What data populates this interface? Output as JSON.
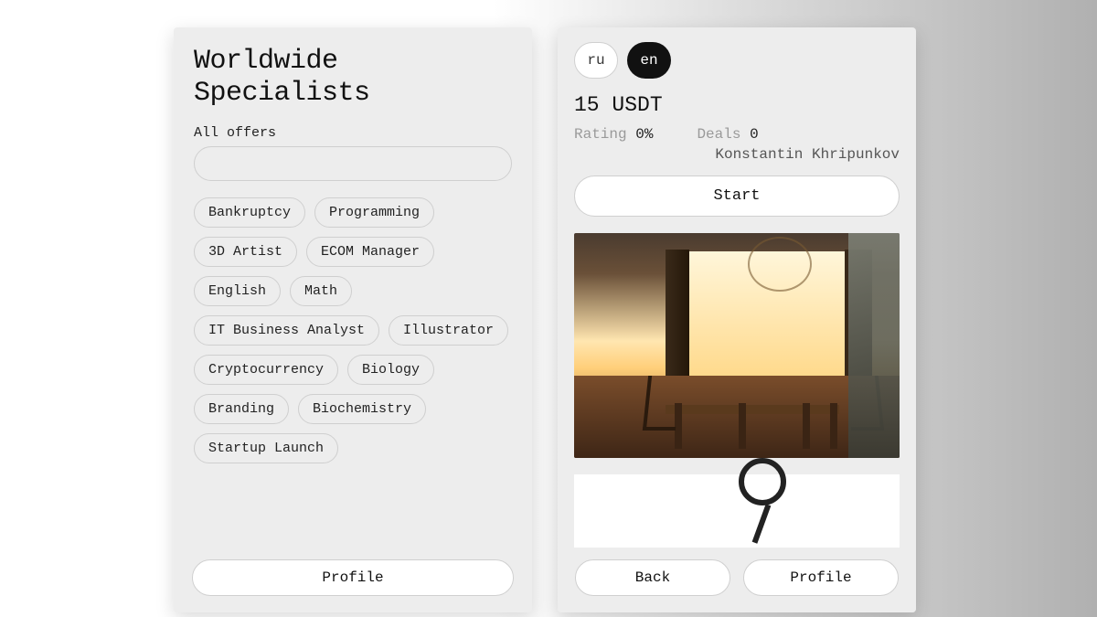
{
  "left": {
    "title_line1": "Worldwide",
    "title_line2": "Specialists",
    "subhead": "All offers",
    "search_value": "",
    "tags": [
      "Bankruptcy",
      "Programming",
      "3D Artist",
      "ECOM Manager",
      "English",
      "Math",
      "IT Business Analyst",
      "Illustrator",
      "Cryptocurrency",
      "Biology",
      "Branding",
      "Biochemistry",
      "Startup Launch"
    ],
    "footer_button": "Profile"
  },
  "right": {
    "lang_inactive": "ru",
    "lang_active": "en",
    "price": "15 USDT",
    "rating_label": "Rating",
    "rating_value": "0%",
    "deals_label": "Deals",
    "deals_value": "0",
    "author": "Konstantin Khripunkov",
    "start_button": "Start",
    "back_button": "Back",
    "profile_button": "Profile"
  }
}
